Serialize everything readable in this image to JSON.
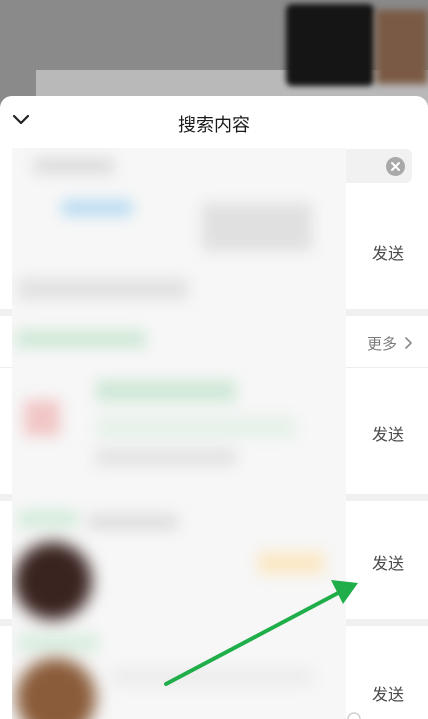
{
  "sheet": {
    "title": "搜索内容",
    "collapse_icon": "chevron-down-icon"
  },
  "search": {
    "clear_icon": "clear-circle-icon"
  },
  "results": [
    {
      "send_label": "发送"
    },
    {
      "send_label": "发送"
    },
    {
      "send_label": "发送"
    },
    {
      "send_label": "发送"
    }
  ],
  "section": {
    "more_label": "更多",
    "more_icon": "chevron-right-icon"
  },
  "annotation": {
    "arrow_color": "#1fae4a"
  },
  "colors": {
    "dim_background": "#8a8a8a",
    "separator": "#f0f0f0",
    "text_secondary": "#4a4a4a"
  }
}
